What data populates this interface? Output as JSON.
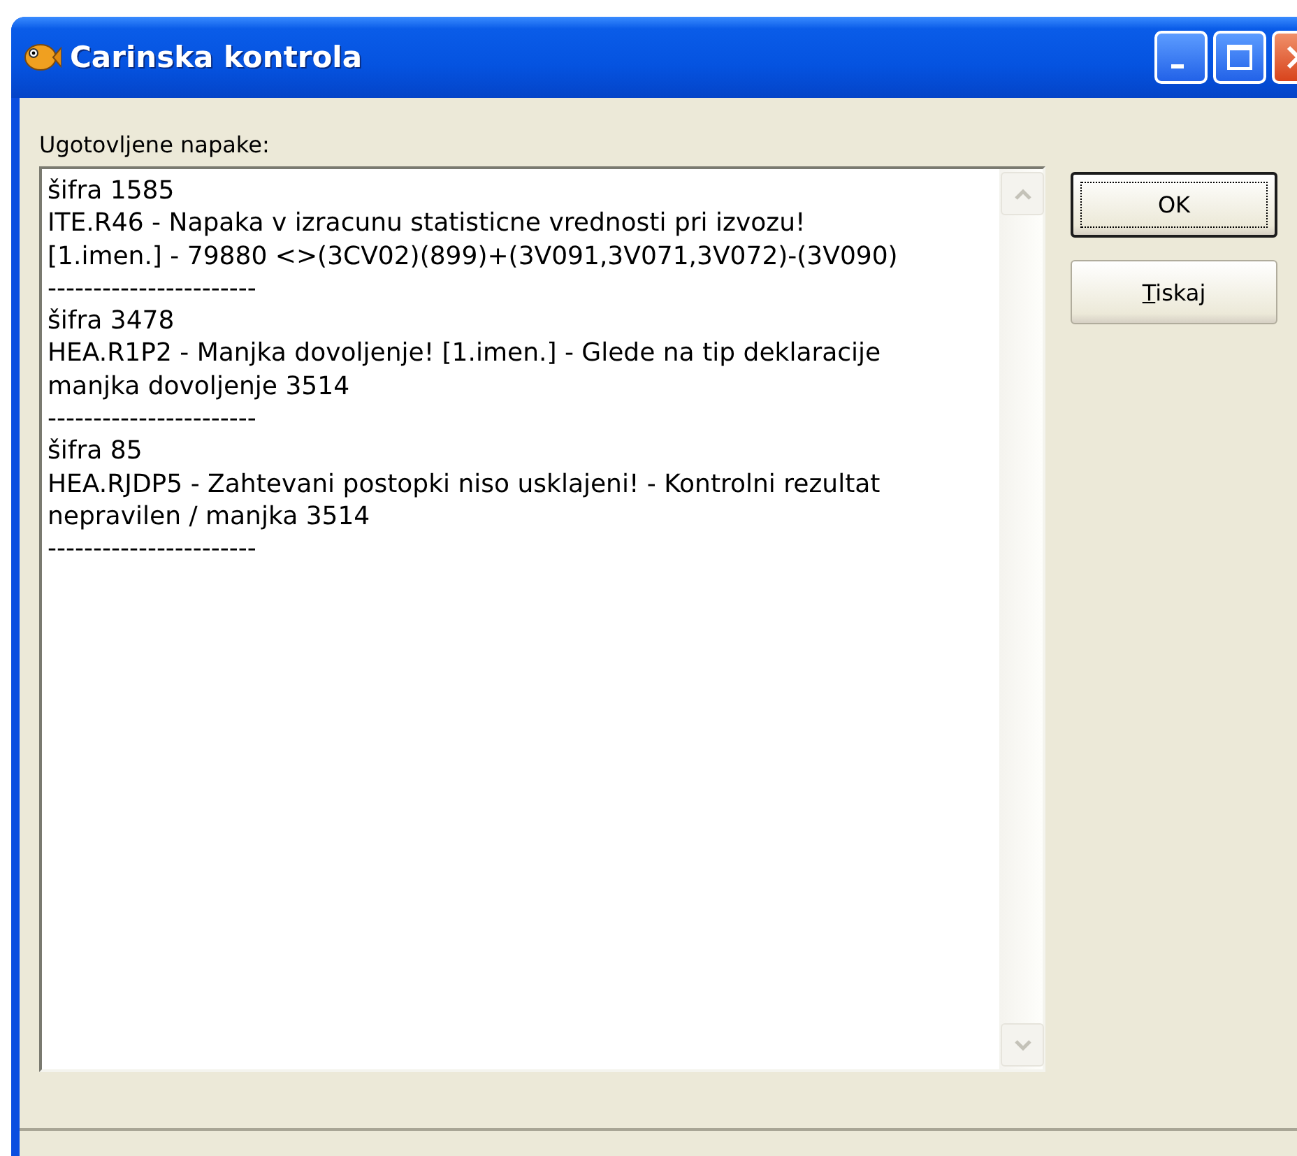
{
  "window": {
    "title": "Carinska kontrola"
  },
  "label": "Ugotovljene napake:",
  "errors_text": {
    "lines": [
      "šifra 1585",
      "ITE.R46 - Napaka v izracunu statisticne vrednosti pri izvozu!",
      "[1.imen.] - 79880 <>(3CV02)(899)+(3V091,3V071,3V072)-(3V090)",
      "-----------------------",
      "šifra 3478",
      "HEA.R1P2 - Manjka dovoljenje! [1.imen.] - Glede na tip deklaracije",
      "manjka dovoljenje 3514",
      "-----------------------",
      "šifra 85",
      "HEA.RJDP5 - Zahtevani postopki niso usklajeni! - Kontrolni rezultat",
      "nepravilen / manjka 3514",
      "-----------------------"
    ]
  },
  "buttons": [
    {
      "label": "OK",
      "default": true,
      "mnemonic": false
    },
    {
      "label": "Tiskaj",
      "default": false,
      "mnemonic": true
    }
  ]
}
